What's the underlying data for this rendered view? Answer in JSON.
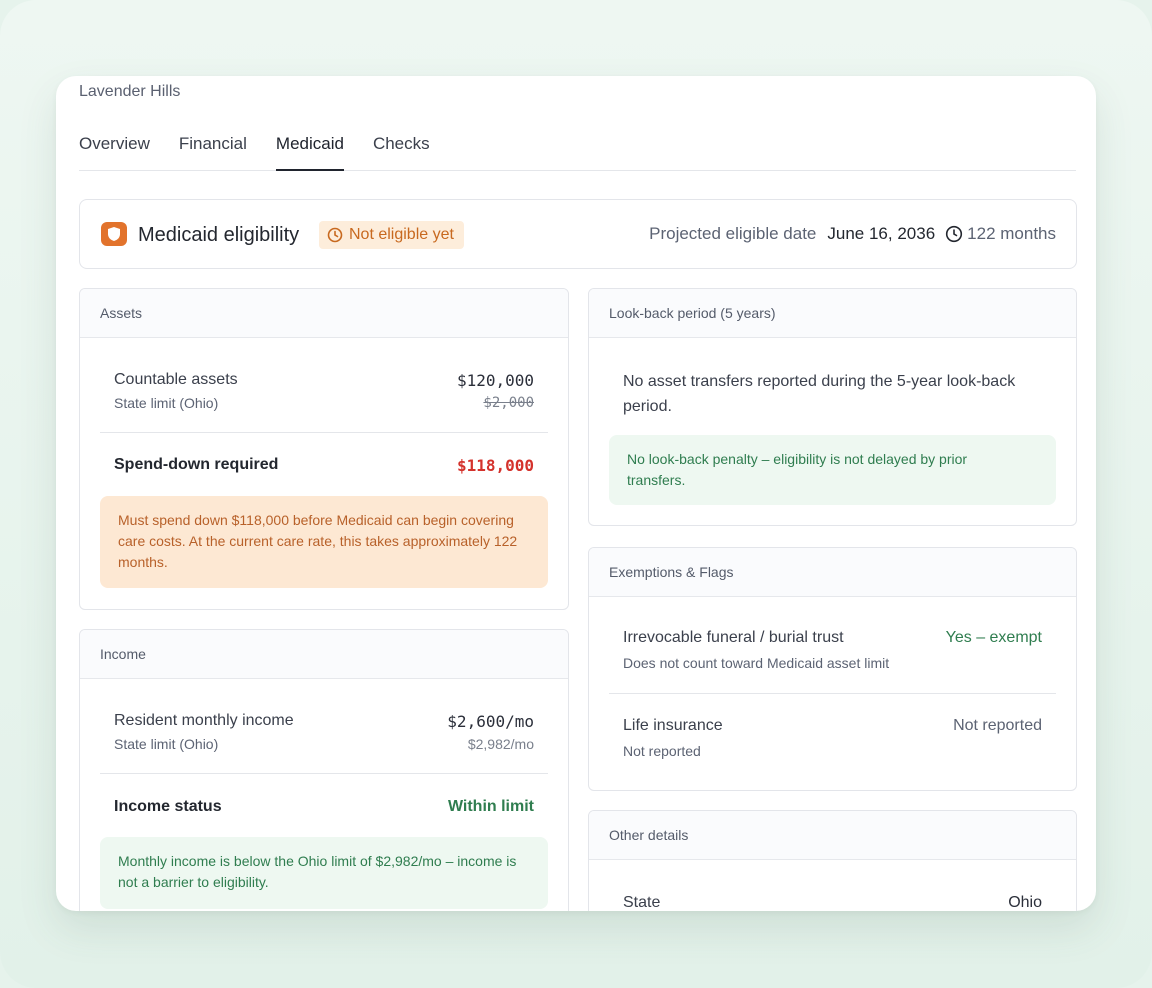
{
  "community": "Lavender Hills",
  "tabs": [
    {
      "label": "Overview"
    },
    {
      "label": "Financial"
    },
    {
      "label": "Medicaid"
    },
    {
      "label": "Checks"
    }
  ],
  "eligibility": {
    "icon": "shield-icon",
    "title": "Medicaid eligibility",
    "status_badge": "Not eligible yet",
    "projected_label": "Projected eligible date",
    "projected_date": "June 16, 2036",
    "months": "122 months"
  },
  "assets": {
    "header": "Assets",
    "countable_label": "Countable assets",
    "countable_value": "$120,000",
    "limit_label": "State limit (Ohio)",
    "limit_value": "$2,000",
    "spend_label": "Spend-down required",
    "spend_value": "$118,000",
    "note": "Must spend down $118,000 before Medicaid can begin covering care costs. At the current care rate, this takes approximately 122 months."
  },
  "income": {
    "header": "Income",
    "monthly_label": "Resident monthly income",
    "monthly_value": "$2,600/mo",
    "limit_label": "State limit (Ohio)",
    "limit_value": "$2,982/mo",
    "status_label": "Income status",
    "status_value": "Within limit",
    "note": "Monthly income is below the Ohio limit of $2,982/mo – income is not a barrier to eligibility."
  },
  "lookback": {
    "header": "Look-back period (5 years)",
    "text": "No asset transfers reported during the 5-year look-back period.",
    "note": "No look-back penalty – eligibility is not delayed by prior transfers."
  },
  "exemptions": {
    "header": "Exemptions & Flags",
    "items": [
      {
        "label": "Irrevocable funeral / burial trust",
        "sub": "Does not count toward Medicaid asset limit",
        "value": "Yes – exempt"
      },
      {
        "label": "Life insurance",
        "sub": "Not reported",
        "value": "Not reported"
      }
    ]
  },
  "other": {
    "header": "Other details",
    "state_label": "State",
    "state_value": "Ohio"
  },
  "colors": {
    "accent_orange": "#e2732c",
    "danger_red": "#d4322c",
    "success_green": "#2f7d4f"
  }
}
